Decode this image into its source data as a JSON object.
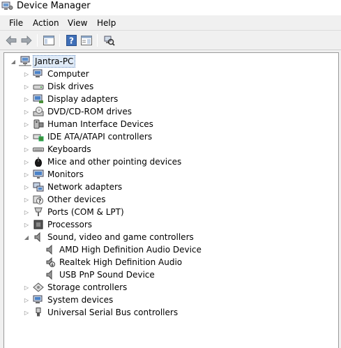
{
  "window": {
    "title": "Device Manager"
  },
  "menu": [
    "File",
    "Action",
    "View",
    "Help"
  ],
  "toolbar": {
    "buttons": [
      "back-icon",
      "forward-icon",
      "show-hide-console-tree-icon",
      "help-icon",
      "properties-icon",
      "scan-hardware-icon"
    ]
  },
  "tree": {
    "root": "Jantra-PC",
    "categories": [
      "Computer",
      "Disk drives",
      "Display adapters",
      "DVD/CD-ROM drives",
      "Human Interface Devices",
      "IDE ATA/ATAPI controllers",
      "Keyboards",
      "Mice and other pointing devices",
      "Monitors",
      "Network adapters",
      "Other devices",
      "Ports (COM & LPT)",
      "Processors",
      "Sound, video and game controllers",
      "Storage controllers",
      "System devices",
      "Universal Serial Bus controllers"
    ],
    "sound_children": [
      "AMD High Definition Audio Device",
      "Realtek High Definition Audio",
      "USB PnP Sound Device"
    ]
  },
  "colors": {
    "selection": "#dfeaf7",
    "window_bg": "#f0f0f0"
  }
}
